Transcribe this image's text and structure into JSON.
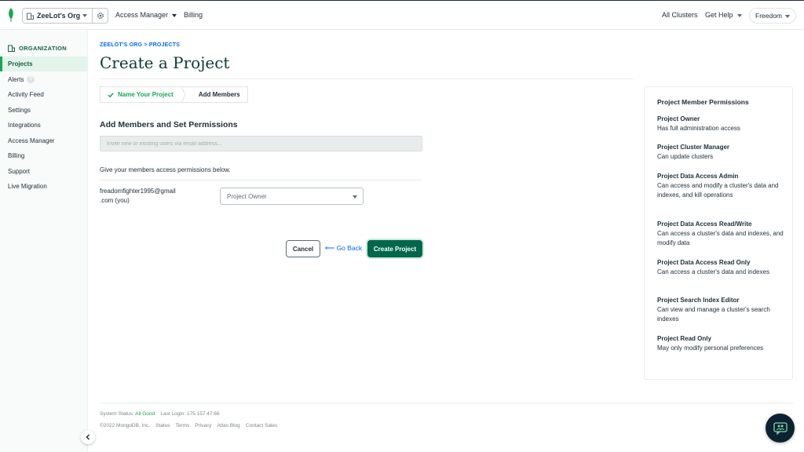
{
  "topbar": {
    "org_name": "ZeeLot's Org",
    "access_manager": "Access Manager",
    "billing": "Billing",
    "all_clusters": "All Clusters",
    "get_help": "Get Help",
    "user_name": "Freedom"
  },
  "sidebar": {
    "header": "ORGANIZATION",
    "items": [
      {
        "label": "Projects",
        "active": true
      },
      {
        "label": "Alerts",
        "badge": "0"
      },
      {
        "label": "Activity Feed"
      },
      {
        "label": "Settings"
      },
      {
        "label": "Integrations"
      },
      {
        "label": "Access Manager"
      },
      {
        "label": "Billing"
      },
      {
        "label": "Support"
      },
      {
        "label": "Live Migration"
      }
    ]
  },
  "main": {
    "breadcrumb": "ZEELOT'S ORG > PROJECTS",
    "title": "Create a Project",
    "steps": [
      {
        "label": "Name Your Project",
        "done": true
      },
      {
        "label": "Add Members"
      }
    ],
    "section_title": "Add Members and Set Permissions",
    "invite_placeholder": "Invite new or existing users via email address...",
    "permissions_text": "Give your members access permissions below.",
    "member": {
      "email_line1": "freadomfighter1995@gmail",
      "email_line2": ".com (you)",
      "role": "Project Owner"
    },
    "buttons": {
      "cancel": "Cancel",
      "back": "Go Back",
      "create": "Create Project"
    }
  },
  "permissions_panel": {
    "title": "Project Member Permissions",
    "roles": [
      {
        "name": "Project Owner",
        "desc": "Has full administration access"
      },
      {
        "name": "Project Cluster Manager",
        "desc": "Can update clusters"
      },
      {
        "name": "Project Data Access Admin",
        "desc": "Can access and modify a cluster's data and indexes, and kill operations"
      },
      {
        "name": "Project Data Access Read/Write",
        "desc": "Can access a cluster's data and indexes, and modify data"
      },
      {
        "name": "Project Data Access Read Only",
        "desc": "Can access a cluster's data and indexes"
      },
      {
        "name": "Project Search Index Editor",
        "desc": "Can view and manage a cluster's search indexes"
      },
      {
        "name": "Project Read Only",
        "desc": "May only modify personal preferences"
      }
    ]
  },
  "footer": {
    "status_label": "System Status:",
    "status_value": "All Good",
    "last_login": "Last Login: 175.157.47.66",
    "copyright": "©2022 MongoDB, Inc.",
    "links": [
      "Status",
      "Terms",
      "Privacy",
      "Atlas Blog",
      "Contact Sales"
    ]
  },
  "colors": {
    "brand_green": "#13aa52",
    "dark_green": "#00684a",
    "link_blue": "#016bf8",
    "title_dark": "#0b3b35"
  }
}
